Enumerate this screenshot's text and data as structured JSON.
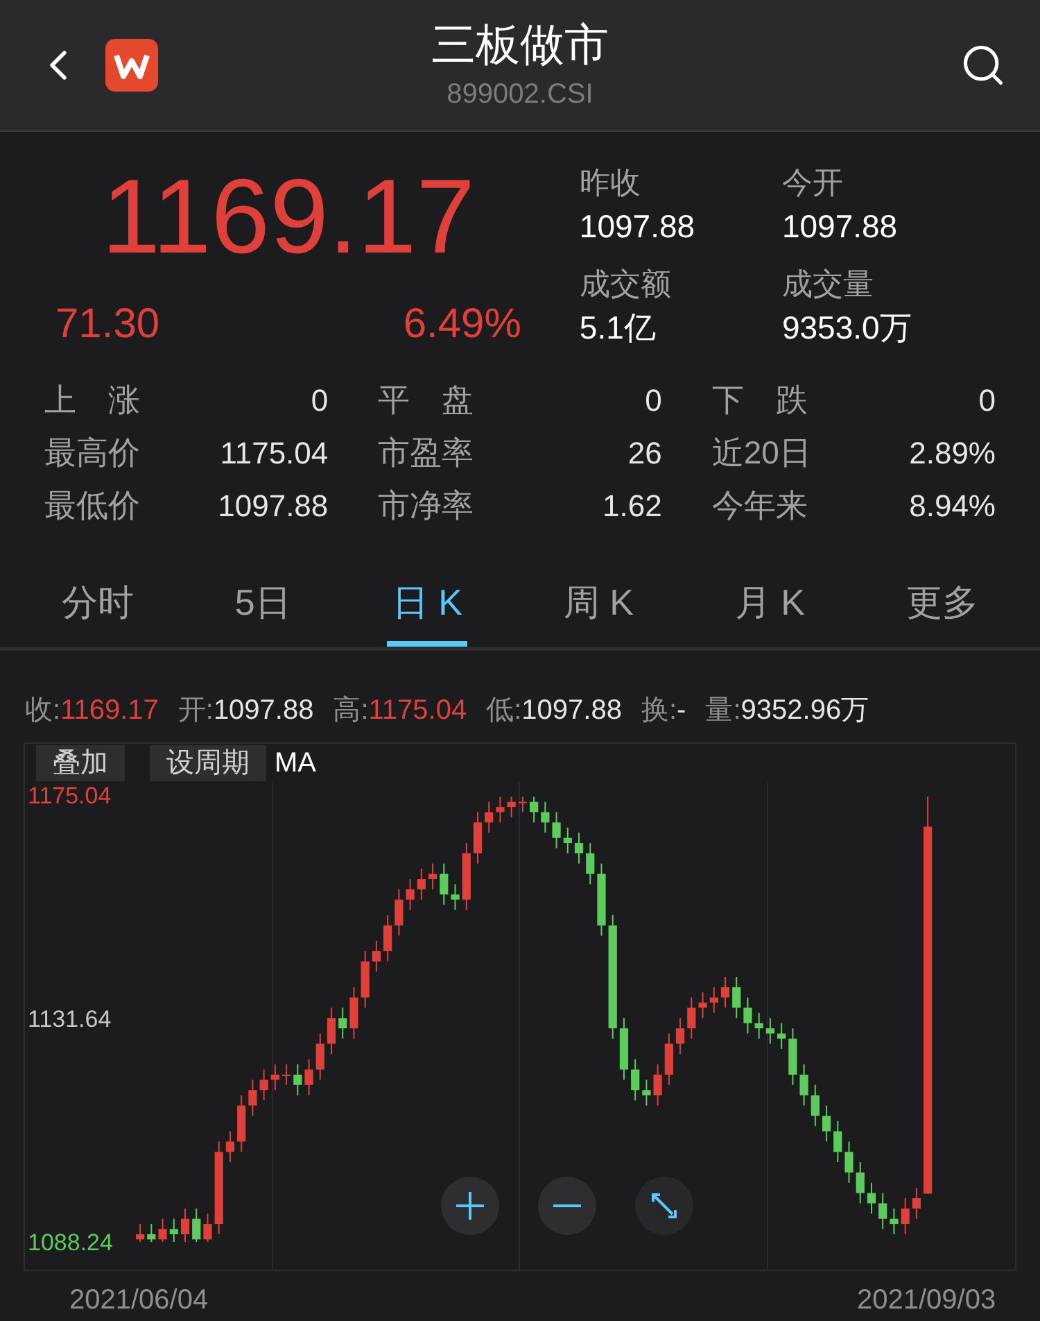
{
  "header": {
    "title": "三板做市",
    "code": "899002.CSI"
  },
  "quote": {
    "price": "1169.17",
    "change": "71.30",
    "change_pct": "6.49%",
    "stats": [
      {
        "label": "昨收",
        "value": "1097.88"
      },
      {
        "label": "今开",
        "value": "1097.88"
      },
      {
        "label": "成交额",
        "value": "5.1亿"
      },
      {
        "label": "成交量",
        "value": "9353.0万"
      }
    ]
  },
  "breadth": [
    {
      "label": "上　涨",
      "value": "0"
    },
    {
      "label": "平　盘",
      "value": "0"
    },
    {
      "label": "下　跌",
      "value": "0"
    },
    {
      "label": "最高价",
      "value": "1175.04"
    },
    {
      "label": "市盈率",
      "value": "26"
    },
    {
      "label": "近20日",
      "value": "2.89%"
    },
    {
      "label": "最低价",
      "value": "1097.88"
    },
    {
      "label": "市净率",
      "value": "1.62"
    },
    {
      "label": "今年来",
      "value": "8.94%"
    }
  ],
  "tabs": [
    {
      "label": "分时",
      "selected": false
    },
    {
      "label": "5日",
      "selected": false
    },
    {
      "label": "日 K",
      "selected": true
    },
    {
      "label": "周 K",
      "selected": false
    },
    {
      "label": "月 K",
      "selected": false
    },
    {
      "label": "更多",
      "selected": false
    }
  ],
  "kline_info": [
    {
      "label": "收:",
      "value": "1169.17",
      "up": true
    },
    {
      "label": "开:",
      "value": "1097.88",
      "up": false
    },
    {
      "label": "高:",
      "value": "1175.04",
      "up": true
    },
    {
      "label": "低:",
      "value": "1097.88",
      "up": false
    },
    {
      "label": "换:",
      "value": "-",
      "up": false
    },
    {
      "label": "量:",
      "value": "9352.96万",
      "up": false
    }
  ],
  "chart_toolbar": {
    "buttons": [
      "叠加",
      "设周期"
    ],
    "indicator": "MA"
  },
  "chart": {
    "chart_data": {
      "type": "candlestick",
      "categories": [
        "2021/06/04",
        null,
        null,
        null,
        null,
        null,
        null,
        null,
        null,
        null,
        null,
        null,
        null,
        null,
        null,
        null,
        null,
        null,
        null,
        null,
        null,
        null,
        null,
        null,
        null,
        null,
        null,
        null,
        null,
        null,
        null,
        null,
        null,
        null,
        null,
        null,
        null,
        null,
        null,
        null,
        null,
        null,
        null,
        null,
        null,
        null,
        null,
        null,
        null,
        null,
        null,
        null,
        null,
        null,
        null,
        null,
        null,
        null,
        null,
        null,
        null,
        null,
        null,
        null,
        null,
        null,
        null,
        null,
        null,
        null,
        "2021/09/03"
      ],
      "yticks": [
        {
          "value": 1175.04,
          "label": "1175.04"
        },
        {
          "value": 1131.64,
          "label": "1131.64"
        },
        {
          "value": 1088.24,
          "label": "1088.24"
        }
      ],
      "ylim": [
        1088.24,
        1175.04
      ],
      "ohlc": [
        [
          1089,
          1092,
          1088.5,
          1090
        ],
        [
          1090,
          1092,
          1088.5,
          1089
        ],
        [
          1089,
          1093,
          1088.5,
          1091
        ],
        [
          1091,
          1093,
          1088.5,
          1090
        ],
        [
          1090,
          1095,
          1088.5,
          1093
        ],
        [
          1093,
          1095,
          1088.5,
          1089
        ],
        [
          1089,
          1094,
          1088.5,
          1092
        ],
        [
          1092,
          1108,
          1090,
          1106
        ],
        [
          1106,
          1110,
          1104,
          1108
        ],
        [
          1108,
          1117,
          1106,
          1115
        ],
        [
          1115,
          1120,
          1113,
          1118
        ],
        [
          1118,
          1122,
          1116,
          1120
        ],
        [
          1120,
          1123,
          1118,
          1121
        ],
        [
          1121,
          1123,
          1119,
          1121
        ],
        [
          1121,
          1123,
          1117,
          1119
        ],
        [
          1119,
          1124,
          1117,
          1122
        ],
        [
          1122,
          1129,
          1120,
          1127
        ],
        [
          1127,
          1134,
          1125,
          1132
        ],
        [
          1132,
          1134,
          1128,
          1130
        ],
        [
          1130,
          1138,
          1128,
          1136
        ],
        [
          1136,
          1145,
          1134,
          1143
        ],
        [
          1143,
          1147,
          1141,
          1145
        ],
        [
          1145,
          1152,
          1143,
          1150
        ],
        [
          1150,
          1157,
          1148,
          1155
        ],
        [
          1155,
          1159,
          1153,
          1157
        ],
        [
          1157,
          1161,
          1155,
          1159
        ],
        [
          1159,
          1162,
          1157,
          1160
        ],
        [
          1160,
          1162,
          1154,
          1156
        ],
        [
          1156,
          1158,
          1153,
          1155
        ],
        [
          1155,
          1166,
          1153,
          1164
        ],
        [
          1164,
          1172,
          1162,
          1170
        ],
        [
          1170,
          1174,
          1168,
          1172
        ],
        [
          1172,
          1175,
          1170,
          1173
        ],
        [
          1173,
          1175,
          1171,
          1174
        ],
        [
          1174,
          1175,
          1172,
          1174
        ],
        [
          1174,
          1175,
          1170,
          1172
        ],
        [
          1172,
          1174,
          1168,
          1170
        ],
        [
          1170,
          1172,
          1165,
          1167
        ],
        [
          1167,
          1169,
          1164,
          1166
        ],
        [
          1166,
          1168,
          1162,
          1164
        ],
        [
          1164,
          1166,
          1158,
          1160
        ],
        [
          1160,
          1162,
          1148,
          1150
        ],
        [
          1150,
          1152,
          1128,
          1130
        ],
        [
          1130,
          1132,
          1120,
          1122
        ],
        [
          1122,
          1124,
          1116,
          1118
        ],
        [
          1118,
          1120,
          1115,
          1117
        ],
        [
          1117,
          1123,
          1115,
          1121
        ],
        [
          1121,
          1129,
          1119,
          1127
        ],
        [
          1127,
          1132,
          1125,
          1130
        ],
        [
          1130,
          1136,
          1128,
          1134
        ],
        [
          1134,
          1137,
          1132,
          1135
        ],
        [
          1135,
          1138,
          1133,
          1136
        ],
        [
          1136,
          1140,
          1134,
          1138
        ],
        [
          1138,
          1140,
          1132,
          1134
        ],
        [
          1134,
          1136,
          1129,
          1131
        ],
        [
          1131,
          1133,
          1128,
          1130
        ],
        [
          1130,
          1132,
          1127,
          1129
        ],
        [
          1129,
          1131,
          1126,
          1128
        ],
        [
          1128,
          1130,
          1119,
          1121
        ],
        [
          1121,
          1123,
          1115,
          1117
        ],
        [
          1117,
          1119,
          1111,
          1113
        ],
        [
          1113,
          1115,
          1108,
          1110
        ],
        [
          1110,
          1112,
          1104,
          1106
        ],
        [
          1106,
          1108,
          1100,
          1102
        ],
        [
          1102,
          1104,
          1096,
          1098
        ],
        [
          1098,
          1100,
          1094,
          1096
        ],
        [
          1096,
          1098,
          1091,
          1093
        ],
        [
          1093,
          1095,
          1090,
          1092
        ],
        [
          1092,
          1097,
          1090,
          1095
        ],
        [
          1095,
          1099,
          1093,
          1097
        ],
        [
          1097.88,
          1175.04,
          1097.88,
          1169.17
        ]
      ]
    }
  }
}
